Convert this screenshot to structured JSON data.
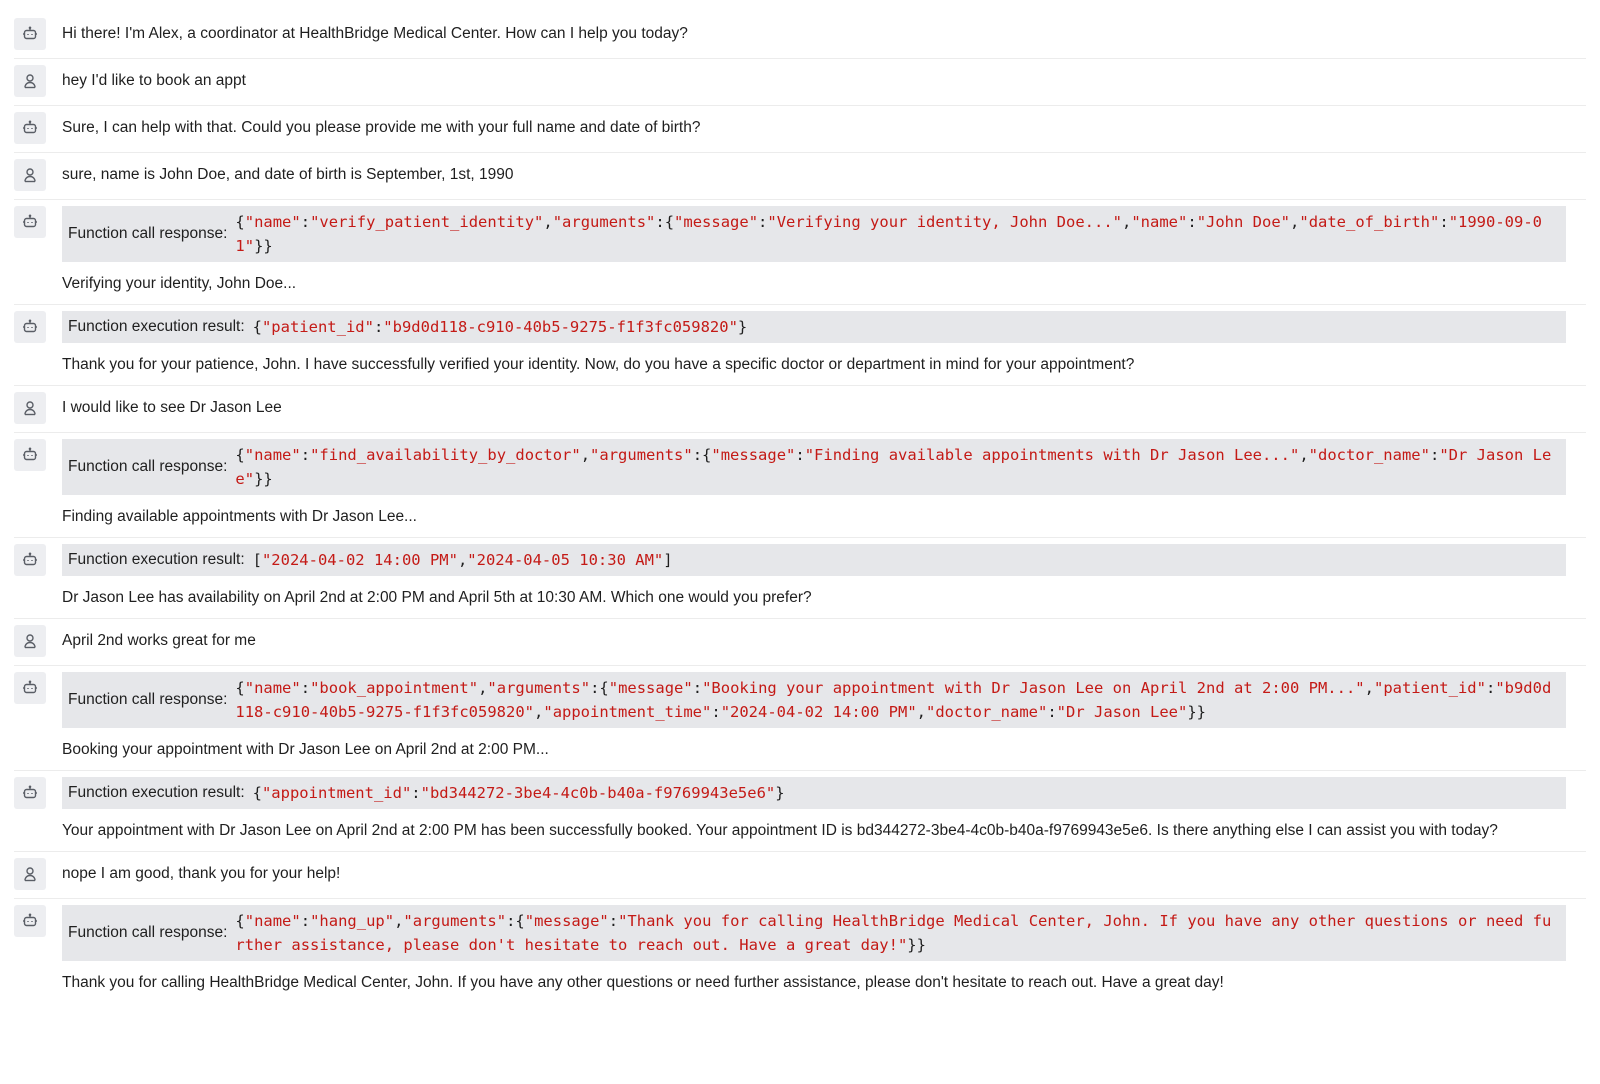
{
  "transcript": [
    {
      "role": "assistant",
      "text": "Hi there! I'm Alex, a coordinator at HealthBridge Medical Center. How can I help you today?"
    },
    {
      "role": "user",
      "text": "hey I'd like to book an appt"
    },
    {
      "role": "assistant",
      "text": "Sure, I can help with that. Could you please provide me with your full name and date of birth?"
    },
    {
      "role": "user",
      "text": "sure, name is John Doe, and date of birth is September, 1st, 1990"
    },
    {
      "role": "assistant",
      "function_label": "Function call response:",
      "function_code": "{\"name\":\"verify_patient_identity\",\"arguments\":{\"message\":\"Verifying your identity, John Doe...\",\"name\":\"John Doe\",\"date_of_birth\":\"1990-09-01\"}}",
      "text": "Verifying your identity, John Doe..."
    },
    {
      "role": "assistant",
      "function_label": "Function execution result:",
      "function_code": "{\"patient_id\":\"b9d0d118-c910-40b5-9275-f1f3fc059820\"}",
      "text": "Thank you for your patience, John. I have successfully verified your identity. Now, do you have a specific doctor or department in mind for your appointment?"
    },
    {
      "role": "user",
      "text": "I would like to see Dr Jason Lee"
    },
    {
      "role": "assistant",
      "function_label": "Function call response:",
      "function_code": "{\"name\":\"find_availability_by_doctor\",\"arguments\":{\"message\":\"Finding available appointments with Dr Jason Lee...\",\"doctor_name\":\"Dr Jason Lee\"}}",
      "text": "Finding available appointments with Dr Jason Lee..."
    },
    {
      "role": "assistant",
      "function_label": "Function execution result:",
      "function_code": "[\"2024-04-02 14:00 PM\",\"2024-04-05 10:30 AM\"]",
      "text": "Dr Jason Lee has availability on April 2nd at 2:00 PM and April 5th at 10:30 AM. Which one would you prefer?"
    },
    {
      "role": "user",
      "text": "April 2nd works great for me"
    },
    {
      "role": "assistant",
      "function_label": "Function call response:",
      "function_code": "{\"name\":\"book_appointment\",\"arguments\":{\"message\":\"Booking your appointment with Dr Jason Lee on April 2nd at 2:00 PM...\",\"patient_id\":\"b9d0d118-c910-40b5-9275-f1f3fc059820\",\"appointment_time\":\"2024-04-02 14:00 PM\",\"doctor_name\":\"Dr Jason Lee\"}}",
      "text": "Booking your appointment with Dr Jason Lee on April 2nd at 2:00 PM..."
    },
    {
      "role": "assistant",
      "function_label": "Function execution result:",
      "function_code": "{\"appointment_id\":\"bd344272-3be4-4c0b-b40a-f9769943e5e6\"}",
      "text": "Your appointment with Dr Jason Lee on April 2nd at 2:00 PM has been successfully booked. Your appointment ID is bd344272-3be4-4c0b-b40a-f9769943e5e6. Is there anything else I can assist you with today?"
    },
    {
      "role": "user",
      "text": "nope I am good, thank you for your help!"
    },
    {
      "role": "assistant",
      "function_label": "Function call response:",
      "function_code": "{\"name\":\"hang_up\",\"arguments\":{\"message\":\"Thank you for calling HealthBridge Medical Center, John. If you have any other questions or need further assistance, please don't hesitate to reach out. Have a great day!\"}}",
      "text": "Thank you for calling HealthBridge Medical Center, John. If you have any other questions or need further assistance, please don't hesitate to reach out. Have a great day!"
    }
  ],
  "icons": {
    "assistant": "robot-icon",
    "user": "person-icon"
  },
  "colors": {
    "string_red": "#c41a16",
    "code_bg": "#e6e7ea",
    "avatar_bg": "#edeef1",
    "divider": "#ececec"
  }
}
